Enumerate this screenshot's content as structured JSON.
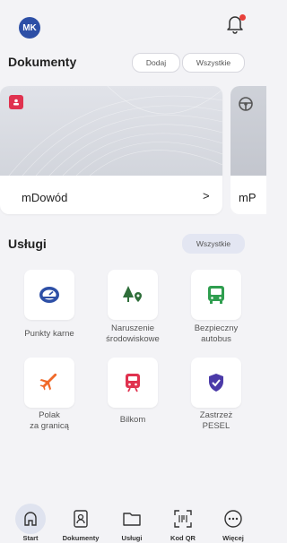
{
  "header": {
    "avatar_initials": "MK",
    "notification_dot": true
  },
  "documents": {
    "title": "Dokumenty",
    "add_label": "Dodaj",
    "all_label": "Wszystkie",
    "cards": [
      {
        "name": "mDowód",
        "arrow": ">"
      },
      {
        "name": "mP"
      }
    ]
  },
  "services": {
    "title": "Usługi",
    "all_label": "Wszystkie",
    "items": [
      {
        "label": "Punkty karne",
        "icon": "speedometer-icon"
      },
      {
        "label": "Naruszenie\nśrodowiskowe",
        "icon": "tree-location-icon"
      },
      {
        "label": "Bezpieczny\nautobus",
        "icon": "bus-icon"
      },
      {
        "label": "Polak\nza granicą",
        "icon": "plane-icon"
      },
      {
        "label": "Bilkom",
        "icon": "train-icon"
      },
      {
        "label": "Zastrzeż\nPESEL",
        "icon": "shield-check-icon"
      }
    ]
  },
  "nav": [
    {
      "label": "Start",
      "icon": "home-icon",
      "active": true
    },
    {
      "label": "Dokumenty",
      "icon": "document-person-icon"
    },
    {
      "label": "Usługi",
      "icon": "folder-icon"
    },
    {
      "label": "Kod QR",
      "icon": "qr-scan-icon"
    },
    {
      "label": "Więcej",
      "icon": "more-icon"
    }
  ],
  "colors": {
    "accent": "#2d4fa6",
    "red": "#e0324f",
    "green": "#2f9e4f",
    "orange": "#f06a2a",
    "purple": "#4b3aa8"
  }
}
